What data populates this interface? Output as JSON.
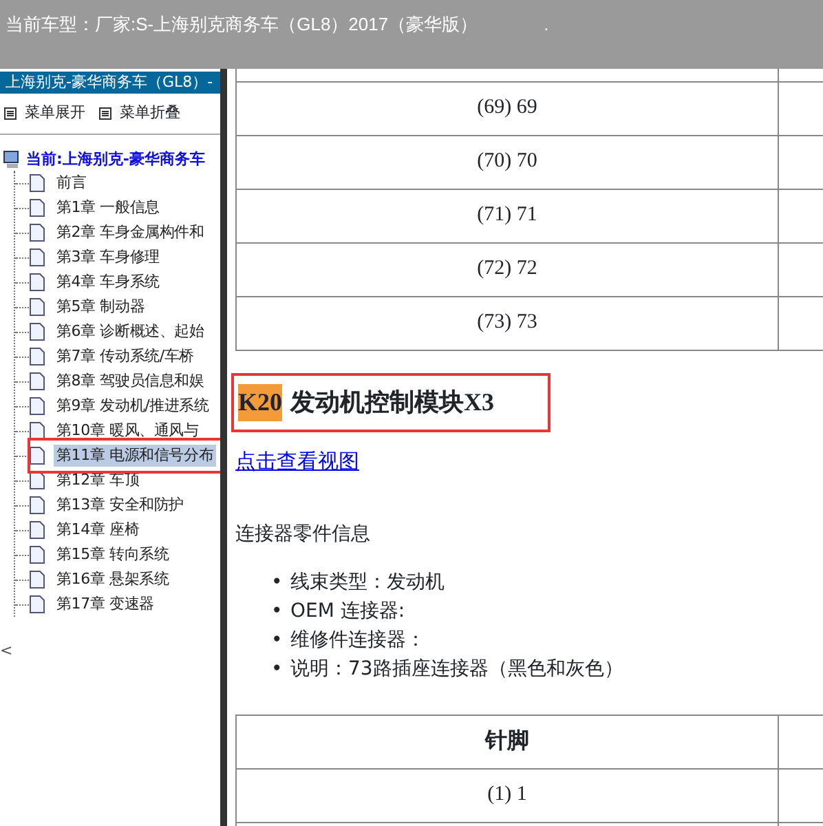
{
  "header": {
    "label": "当前车型：",
    "value": "厂家:S-上海别克商务车（GL8）2017（豪华版）",
    "dot": "."
  },
  "sidebar": {
    "title": "上海别克-豪华商务车（GL8）-",
    "menu": [
      "菜单展开",
      "菜单折叠"
    ],
    "root": "当前:上海别克-豪华商务车",
    "items": [
      {
        "label": "前言",
        "selected": false
      },
      {
        "label": "第1章 一般信息",
        "selected": false
      },
      {
        "label": "第2章 车身金属构件和",
        "selected": false
      },
      {
        "label": "第3章 车身修理",
        "selected": false
      },
      {
        "label": "第4章 车身系统",
        "selected": false
      },
      {
        "label": "第5章 制动器",
        "selected": false
      },
      {
        "label": "第6章 诊断概述、起始",
        "selected": false
      },
      {
        "label": "第7章 传动系统/车桥",
        "selected": false
      },
      {
        "label": "第8章 驾驶员信息和娱",
        "selected": false
      },
      {
        "label": "第9章 发动机/推进系统",
        "selected": false
      },
      {
        "label": "第10章 暖风、通风与",
        "selected": false
      },
      {
        "label": "第11章 电源和信号分布",
        "selected": true
      },
      {
        "label": "第12章 车顶",
        "selected": false
      },
      {
        "label": "第13章 安全和防护",
        "selected": false
      },
      {
        "label": "第14章 座椅",
        "selected": false
      },
      {
        "label": "第15章 转向系统",
        "selected": false
      },
      {
        "label": "第16章 悬架系统",
        "selected": false
      },
      {
        "label": "第17章 变速器",
        "selected": false
      }
    ],
    "collapse": "<"
  },
  "content": {
    "top_rows": [
      "(69) 69",
      "(70) 70",
      "(71) 71",
      "(72) 72",
      "(73) 73"
    ],
    "code": "K20",
    "heading": "发动机控制模块X3",
    "link": "点击查看视图",
    "paragraph": "连接器零件信息",
    "bullets": [
      {
        "marker": "•",
        "text": "线束类型：发动机"
      },
      {
        "marker": "•",
        "text": "OEM 连接器:"
      },
      {
        "marker": "•",
        "text": "维修件连接器："
      },
      {
        "marker": "•",
        "text": "说明：73路插座连接器（黑色和灰色）"
      }
    ],
    "pin_table": {
      "columns": [
        "针脚"
      ],
      "rows": [
        "(1) 1"
      ]
    }
  }
}
